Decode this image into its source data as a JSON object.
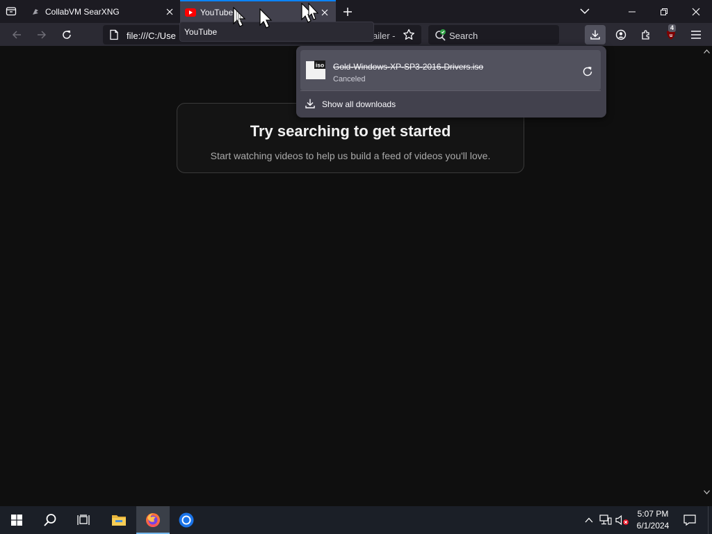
{
  "tabs": [
    {
      "label": "CollabVM SearXNG",
      "active": false,
      "favicon": "searxng-icon"
    },
    {
      "label": "YouTube",
      "active": true,
      "favicon": "youtube-icon"
    }
  ],
  "tooltip": {
    "text": "YouTube"
  },
  "navbar": {
    "url": "file:///C:/Use",
    "url_tail": "ailer -",
    "search_placeholder": "Search",
    "extensions_badge": "4"
  },
  "content": {
    "heading": "Try searching to get started",
    "subtext": "Start watching videos to help us build a feed of videos you'll love."
  },
  "downloads": {
    "file_type_label": "iso",
    "item": {
      "filename": "Gold-Windows-XP-SP3-2016-Drivers.iso",
      "status": "Canceled"
    },
    "show_all_label": "Show all downloads"
  },
  "taskbar": {
    "time": "5:07 PM",
    "date": "6/1/2024"
  },
  "colors": {
    "accent": "#0a84ff",
    "youtube_red": "#ff0000",
    "toolbar_bg": "#2b2a33",
    "tabstrip_bg": "#1c1b22",
    "content_bg": "#0f0f0f",
    "taskbar_bg": "#1b1f27"
  }
}
